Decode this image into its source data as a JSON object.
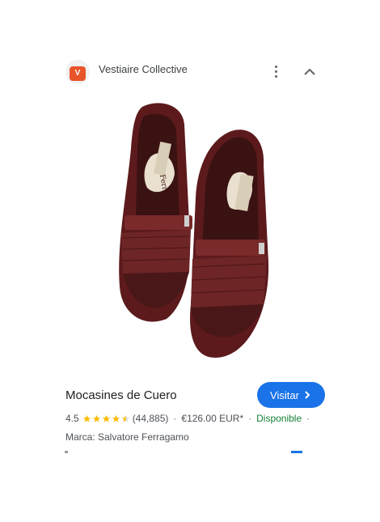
{
  "header": {
    "source_name": "Vestiaire Collective",
    "favicon_letter": "V",
    "accent": "#e8542a"
  },
  "image": {
    "brand_mark": "Ferragamo",
    "shoe_color": "#6b1f1f"
  },
  "product": {
    "title": "Mocasines de Cuero",
    "visit_label": "Visitar",
    "rating": "4.5",
    "rating_value": 4.5,
    "reviews": "(44,885)",
    "price": "€126.00 EUR*",
    "availability": "Disponible",
    "brand_line": "Marca: Salvatore Ferragamo"
  },
  "colors": {
    "link_blue": "#1a73e8",
    "available_green": "#188038",
    "star": "#fbbc04"
  }
}
